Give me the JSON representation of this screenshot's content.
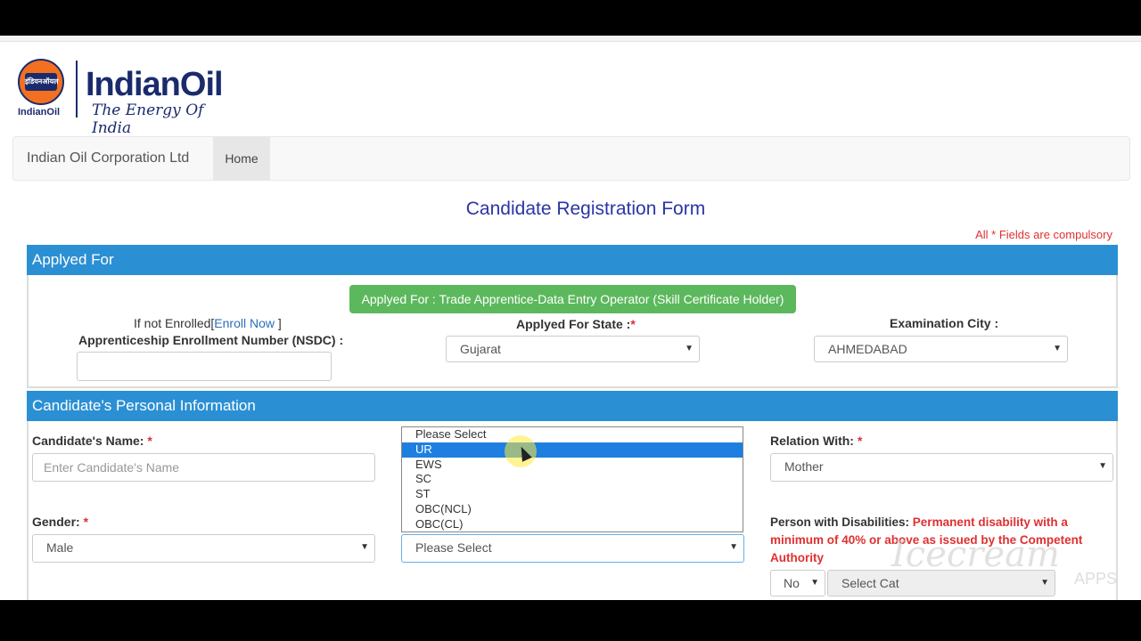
{
  "logo": {
    "circle_text": "इंडियनऑयल",
    "small": "IndianOil",
    "brand": "IndianOil",
    "tagline": "The Energy Of India"
  },
  "nav": {
    "brand": "Indian Oil Corporation Ltd",
    "home": "Home"
  },
  "form": {
    "title": "Candidate Registration Form",
    "compulsory_note": "All * Fields are compulsory"
  },
  "applied_section": {
    "header": "Applyed For",
    "badge": "Applyed For : Trade Apprentice-Data Entry Operator (Skill Certificate Holder)",
    "enroll_prefix": "If not Enrolled[",
    "enroll_link": "Enroll Now",
    "enroll_suffix": " ]",
    "nsdc_label": "Apprenticeship Enrollment Number (NSDC) :",
    "nsdc_value": "",
    "state_label": "Applyed For State :",
    "state_value": "Gujarat",
    "city_label": "Examination City :",
    "city_value": "AHMEDABAD"
  },
  "personal_section": {
    "header": "Candidate's Personal Information",
    "name_label": "Candidate's Name: ",
    "name_placeholder": "Enter Candidate's Name",
    "relation_label": "Relation With: ",
    "relation_value": "Mother",
    "gender_label": "Gender: ",
    "gender_value": "Male",
    "category_value": "Please Select",
    "category_options": [
      "Please Select",
      "UR",
      "EWS",
      "SC",
      "ST",
      "OBC(NCL)",
      "OBC(CL)"
    ],
    "category_highlighted": "UR",
    "disability_label": "Person with Disabilities: ",
    "disability_note": "Permanent disability with a minimum of 40% or above as issued by the Competent Authority",
    "disability_value": "No",
    "disability_category": "Select Cat"
  },
  "required_mark": "*",
  "watermark": {
    "text": "Icecream",
    "sub": "APPS"
  }
}
